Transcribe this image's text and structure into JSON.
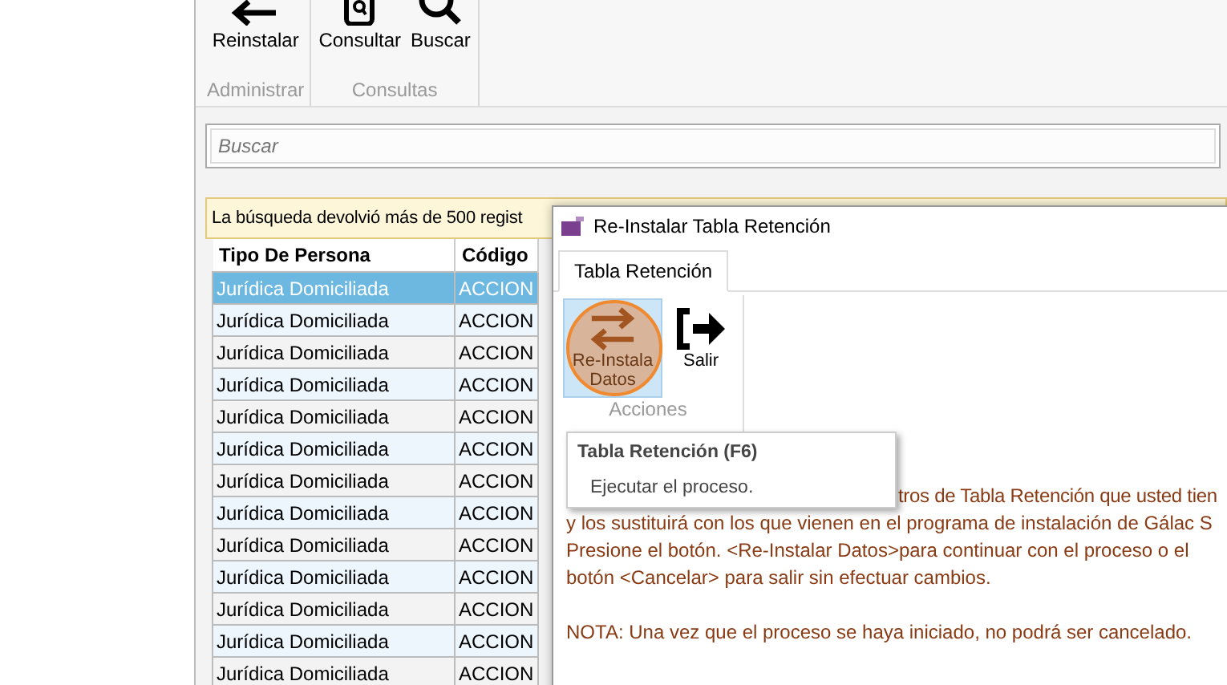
{
  "ribbon": {
    "groups": [
      {
        "label": "Administrar",
        "buttons": [
          {
            "label": "Reinstalar",
            "kind": "back"
          }
        ]
      },
      {
        "label": "Consultas",
        "buttons": [
          {
            "label": "Consultar",
            "kind": "document"
          },
          {
            "label": "Buscar",
            "kind": "search"
          }
        ]
      }
    ]
  },
  "search": {
    "placeholder": "Buscar"
  },
  "notice": "La búsqueda devolvió más de 500 regist",
  "table": {
    "columns": [
      "Tipo De Persona",
      "Código"
    ],
    "rows": [
      {
        "cells": [
          "Jurídica Domiciliada",
          "ACCION"
        ],
        "selected": true
      },
      {
        "cells": [
          "Jurídica Domiciliada",
          "ACCION"
        ],
        "selected": false
      },
      {
        "cells": [
          "Jurídica Domiciliada",
          "ACCION"
        ],
        "selected": false
      },
      {
        "cells": [
          "Jurídica Domiciliada",
          "ACCION"
        ],
        "selected": false
      },
      {
        "cells": [
          "Jurídica Domiciliada",
          "ACCION"
        ],
        "selected": false
      },
      {
        "cells": [
          "Jurídica Domiciliada",
          "ACCION"
        ],
        "selected": false
      },
      {
        "cells": [
          "Jurídica Domiciliada",
          "ACCION"
        ],
        "selected": false
      },
      {
        "cells": [
          "Jurídica Domiciliada",
          "ACCION"
        ],
        "selected": false
      },
      {
        "cells": [
          "Jurídica Domiciliada",
          "ACCION"
        ],
        "selected": false
      },
      {
        "cells": [
          "Jurídica Domiciliada",
          "ACCION"
        ],
        "selected": false
      },
      {
        "cells": [
          "Jurídica Domiciliada",
          "ACCION"
        ],
        "selected": false
      },
      {
        "cells": [
          "Jurídica Domiciliada",
          "ACCION"
        ],
        "selected": false
      },
      {
        "cells": [
          "Jurídica Domiciliada",
          "ACCION"
        ],
        "selected": false
      }
    ]
  },
  "dialog": {
    "title": "Re-Instalar Tabla Retención",
    "tabs": [
      {
        "label": "Tabla Retención",
        "selected": true
      }
    ],
    "group": {
      "label": "Acciones",
      "buttons": [
        {
          "label": [
            "Re-Instala",
            "Datos"
          ],
          "kind": "swap",
          "selected": true
        },
        {
          "label": [
            "Salir"
          ],
          "kind": "exit",
          "selected": false
        }
      ]
    },
    "tooltip": {
      "title": "Tabla Retención (F6)",
      "text": "Ejecutar el proceso."
    },
    "message": [
      "tros de Tabla Retención que usted tien",
      "y los sustituirá con los que vienen en el programa de instalación de Gálac S",
      "Presione el botón.  <Re-Instalar Datos>para continuar con el proceso o el",
      "botón <Cancelar> para salir sin efectuar cambios."
    ],
    "note": "NOTA: Una vez que el proceso se haya iniciado, no podrá ser cancelado."
  }
}
